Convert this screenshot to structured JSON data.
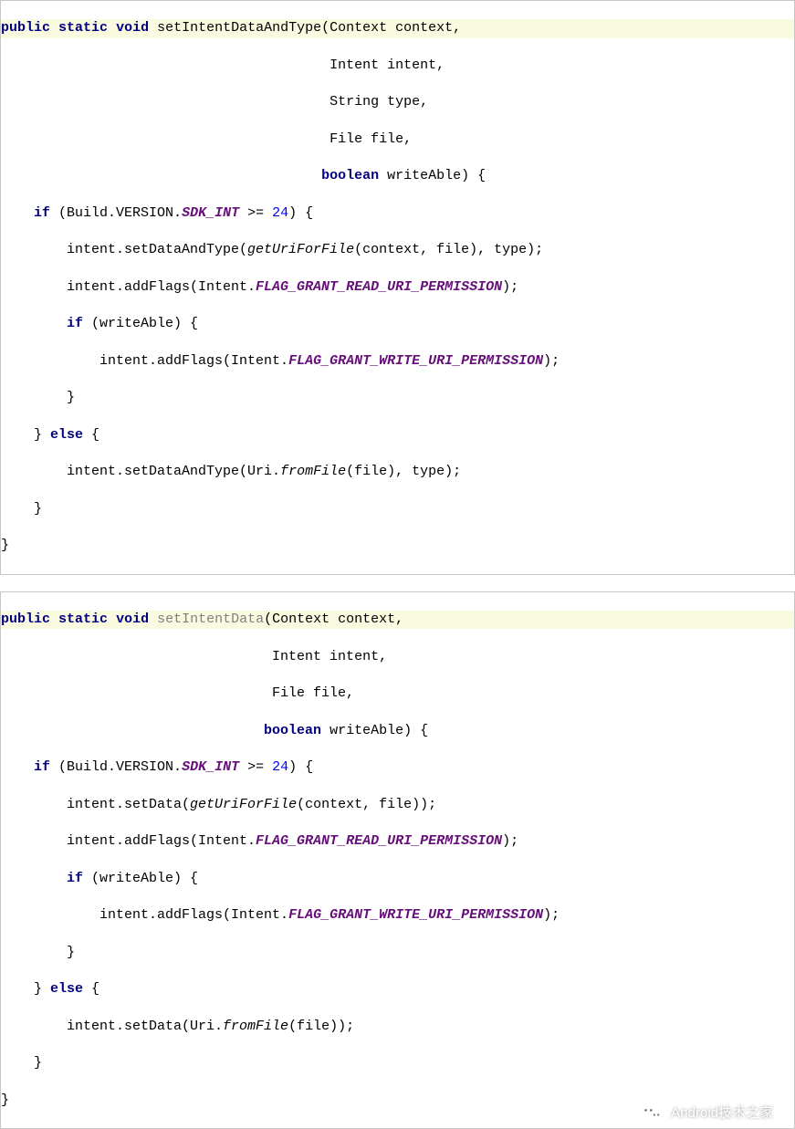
{
  "block1": {
    "sig": {
      "kw_public": "public",
      "kw_static": "static",
      "kw_void": "void",
      "method": "setIntentDataAndType",
      "param1": "(Context context,",
      "param2": " Intent intent,",
      "param3": " String type,",
      "param4": " File file,",
      "param5_kw": "boolean",
      "param5_rest": " writeAble) {"
    },
    "body": {
      "l1_a": "if",
      "l1_b": " (Build.VERSION.",
      "l1_sdk": "SDK_INT",
      "l1_c": " >= ",
      "l1_num": "24",
      "l1_d": ") {",
      "l2_a": "        intent.setDataAndType(",
      "l2_m": "getUriForFile",
      "l2_b": "(context, file), type);",
      "l3_a": "        intent.addFlags(Intent.",
      "l3_f": "FLAG_GRANT_READ_URI_PERMISSION",
      "l3_b": ");",
      "l4_a": "if",
      "l4_b": " (writeAble) {",
      "l5_a": "            intent.addFlags(Intent.",
      "l5_f": "FLAG_GRANT_WRITE_URI_PERMISSION",
      "l5_b": ");",
      "l6": "        }",
      "l7_a": "    } ",
      "l7_else": "else",
      "l7_b": " {",
      "l8_a": "        intent.setDataAndType(Uri.",
      "l8_m": "fromFile",
      "l8_b": "(file), type);",
      "l9": "    }",
      "l10": "}"
    }
  },
  "block2": {
    "sig": {
      "kw_public": "public",
      "kw_static": "static",
      "kw_void": "void",
      "method": "setIntentData",
      "param1": "(Context context,",
      "param2": " Intent intent,",
      "param3": " File file,",
      "param4_kw": "boolean",
      "param4_rest": " writeAble) {"
    },
    "body": {
      "l1_a": "if",
      "l1_b": " (Build.VERSION.",
      "l1_sdk": "SDK_INT",
      "l1_c": " >= ",
      "l1_num": "24",
      "l1_d": ") {",
      "l2_a": "        intent.setData(",
      "l2_m": "getUriForFile",
      "l2_b": "(context, file));",
      "l3_a": "        intent.addFlags(Intent.",
      "l3_f": "FLAG_GRANT_READ_URI_PERMISSION",
      "l3_b": ");",
      "l4_a": "if",
      "l4_b": " (writeAble) {",
      "l5_a": "            intent.addFlags(Intent.",
      "l5_f": "FLAG_GRANT_WRITE_URI_PERMISSION",
      "l5_b": ");",
      "l6": "        }",
      "l7_a": "    } ",
      "l7_else": "else",
      "l7_b": " {",
      "l8_a": "        intent.setData(Uri.",
      "l8_m": "fromFile",
      "l8_b": "(file));",
      "l9": "    }",
      "l10": "}"
    }
  },
  "watermark": {
    "text": "Android技术之家"
  }
}
